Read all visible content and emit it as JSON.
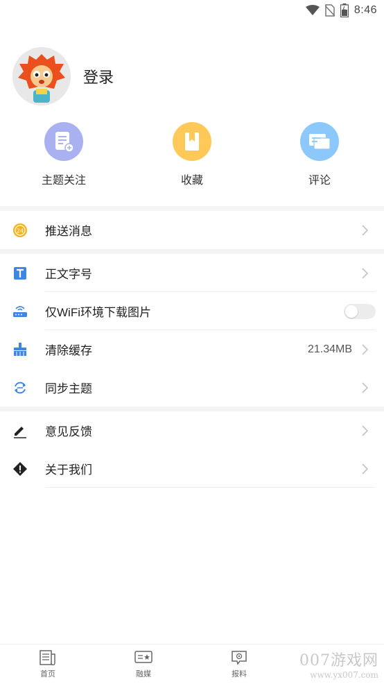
{
  "status_bar": {
    "time": "8:46",
    "icons": [
      "wifi-icon",
      "no-sim-icon",
      "battery-icon"
    ]
  },
  "profile": {
    "login_label": "登录",
    "avatar": "mascot-avatar"
  },
  "quick_actions": [
    {
      "label": "主题关注",
      "icon": "topic-follow-icon",
      "color": "#a9b1f0"
    },
    {
      "label": "收藏",
      "icon": "favorites-icon",
      "color": "#ffc95a"
    },
    {
      "label": "评论",
      "icon": "comments-icon",
      "color": "#8cc8fb"
    }
  ],
  "settings": {
    "push": {
      "label": "推送消息",
      "icon": "push-24-icon"
    },
    "font_size": {
      "label": "正文字号",
      "icon": "text-size-icon"
    },
    "wifi_images": {
      "label": "仅WiFi环境下载图片",
      "icon": "router-icon",
      "enabled": false
    },
    "clear_cache": {
      "label": "清除缓存",
      "value": "21.34MB",
      "icon": "broom-icon"
    },
    "sync_topics": {
      "label": "同步主题",
      "icon": "sync-icon"
    },
    "feedback": {
      "label": "意见反馈",
      "icon": "pencil-icon"
    },
    "about": {
      "label": "关于我们",
      "icon": "info-diamond-icon"
    }
  },
  "tabbar": [
    {
      "label": "首页",
      "icon": "home-news-icon"
    },
    {
      "label": "融媒",
      "icon": "media-icon"
    },
    {
      "label": "报料",
      "icon": "report-icon"
    }
  ],
  "watermark": {
    "big": "007游戏网",
    "small": "www.yx007.com"
  },
  "colors": {
    "icon_blue": "#3e86e0",
    "chevron": "#c2c2c2",
    "badge_orange": "#f6b21c"
  }
}
